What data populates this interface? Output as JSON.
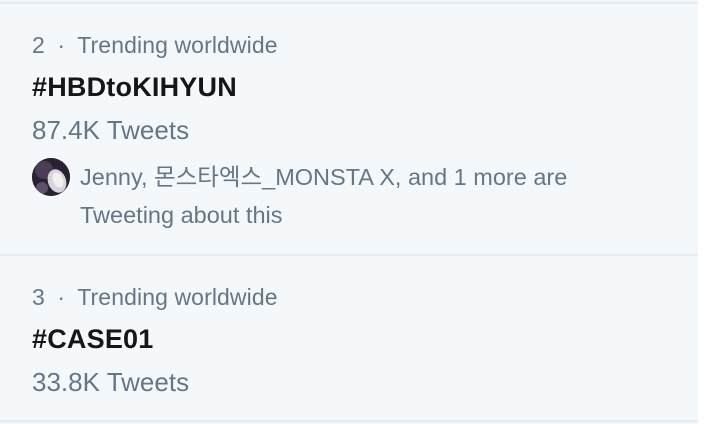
{
  "trends": [
    {
      "rank": "2",
      "category": "Trending worldwide",
      "hashtag": "#HBDtoKIHYUN",
      "tweet_count": "87.4K Tweets",
      "context_line1": "Jenny, 몬스타엑스_MONSTA X, and 1 more are",
      "context_line2": "Tweeting about this"
    },
    {
      "rank": "3",
      "category": "Trending worldwide",
      "hashtag": "#CASE01",
      "tweet_count": "33.8K Tweets"
    }
  ],
  "separator": "·",
  "colors": {
    "background": "#f5f8fa",
    "primary_text": "#14171a",
    "secondary_text": "#657786",
    "divider": "#e6ecf0"
  },
  "icons": {
    "context_avatar": "avatar-icon"
  }
}
